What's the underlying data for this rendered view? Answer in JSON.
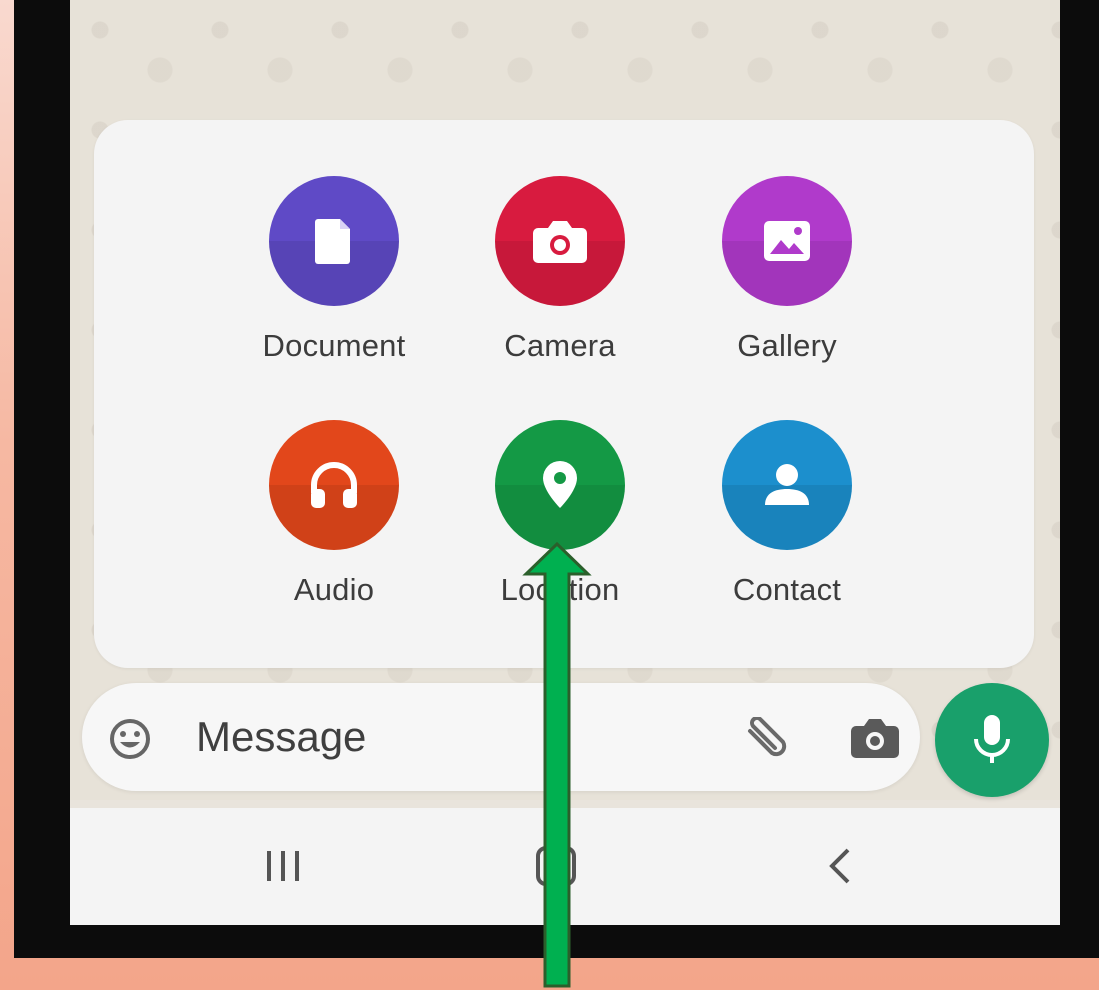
{
  "attach_menu": {
    "options": [
      {
        "label": "Document",
        "icon": "document-icon",
        "color": "#5f4ac6"
      },
      {
        "label": "Camera",
        "icon": "camera-icon",
        "color": "#d81b3f"
      },
      {
        "label": "Gallery",
        "icon": "gallery-icon",
        "color": "#b03acb"
      },
      {
        "label": "Audio",
        "icon": "headphones-icon",
        "color": "#e2471b"
      },
      {
        "label": "Location",
        "icon": "location-pin-icon",
        "color": "#149945"
      },
      {
        "label": "Contact",
        "icon": "contact-person-icon",
        "color": "#1c8fcd"
      }
    ]
  },
  "message_bar": {
    "placeholder": "Message",
    "mic_color": "#19a06b"
  },
  "annotation": {
    "arrow_color": "#00b050",
    "target": "Location"
  }
}
